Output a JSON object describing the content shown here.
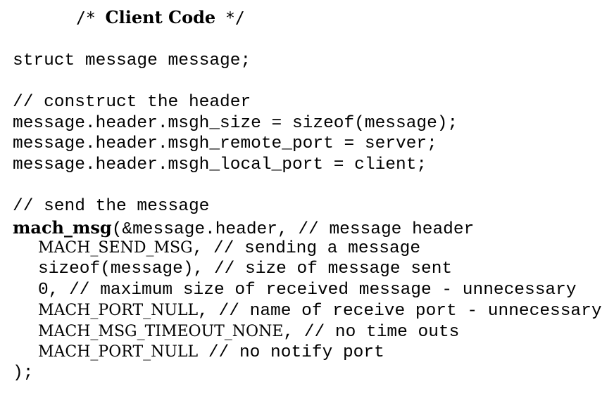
{
  "title": {
    "open": "/* ",
    "text": "Client Code",
    "close": " */"
  },
  "code": {
    "l1": "struct message message;",
    "l3": "// construct the header",
    "l4": "message.header.msgh_size = sizeof(message);",
    "l5": "message.header.msgh_remote_port = server;",
    "l6": "message.header.msgh_local_port = client;",
    "l8": "// send the message",
    "l9_fn": "mach_msg",
    "l9_rest": "(&message.header, // message header",
    "l10_id": "MACH_SEND_MSG",
    "l10_rest": ", // sending a message",
    "l11": "sizeof(message), // size of message sent",
    "l12": "0, // maximum size of received message - unnecessary",
    "l13_id": "MACH_PORT_NULL",
    "l13_rest": ", // name of receive port - unnecessary",
    "l14_id": "MACH_MSG_TIMEOUT_NONE",
    "l14_rest": ", // no time outs",
    "l15_id": "MACH_PORT_NULL",
    "l15_rest": " // no notify port",
    "l16": ");"
  }
}
